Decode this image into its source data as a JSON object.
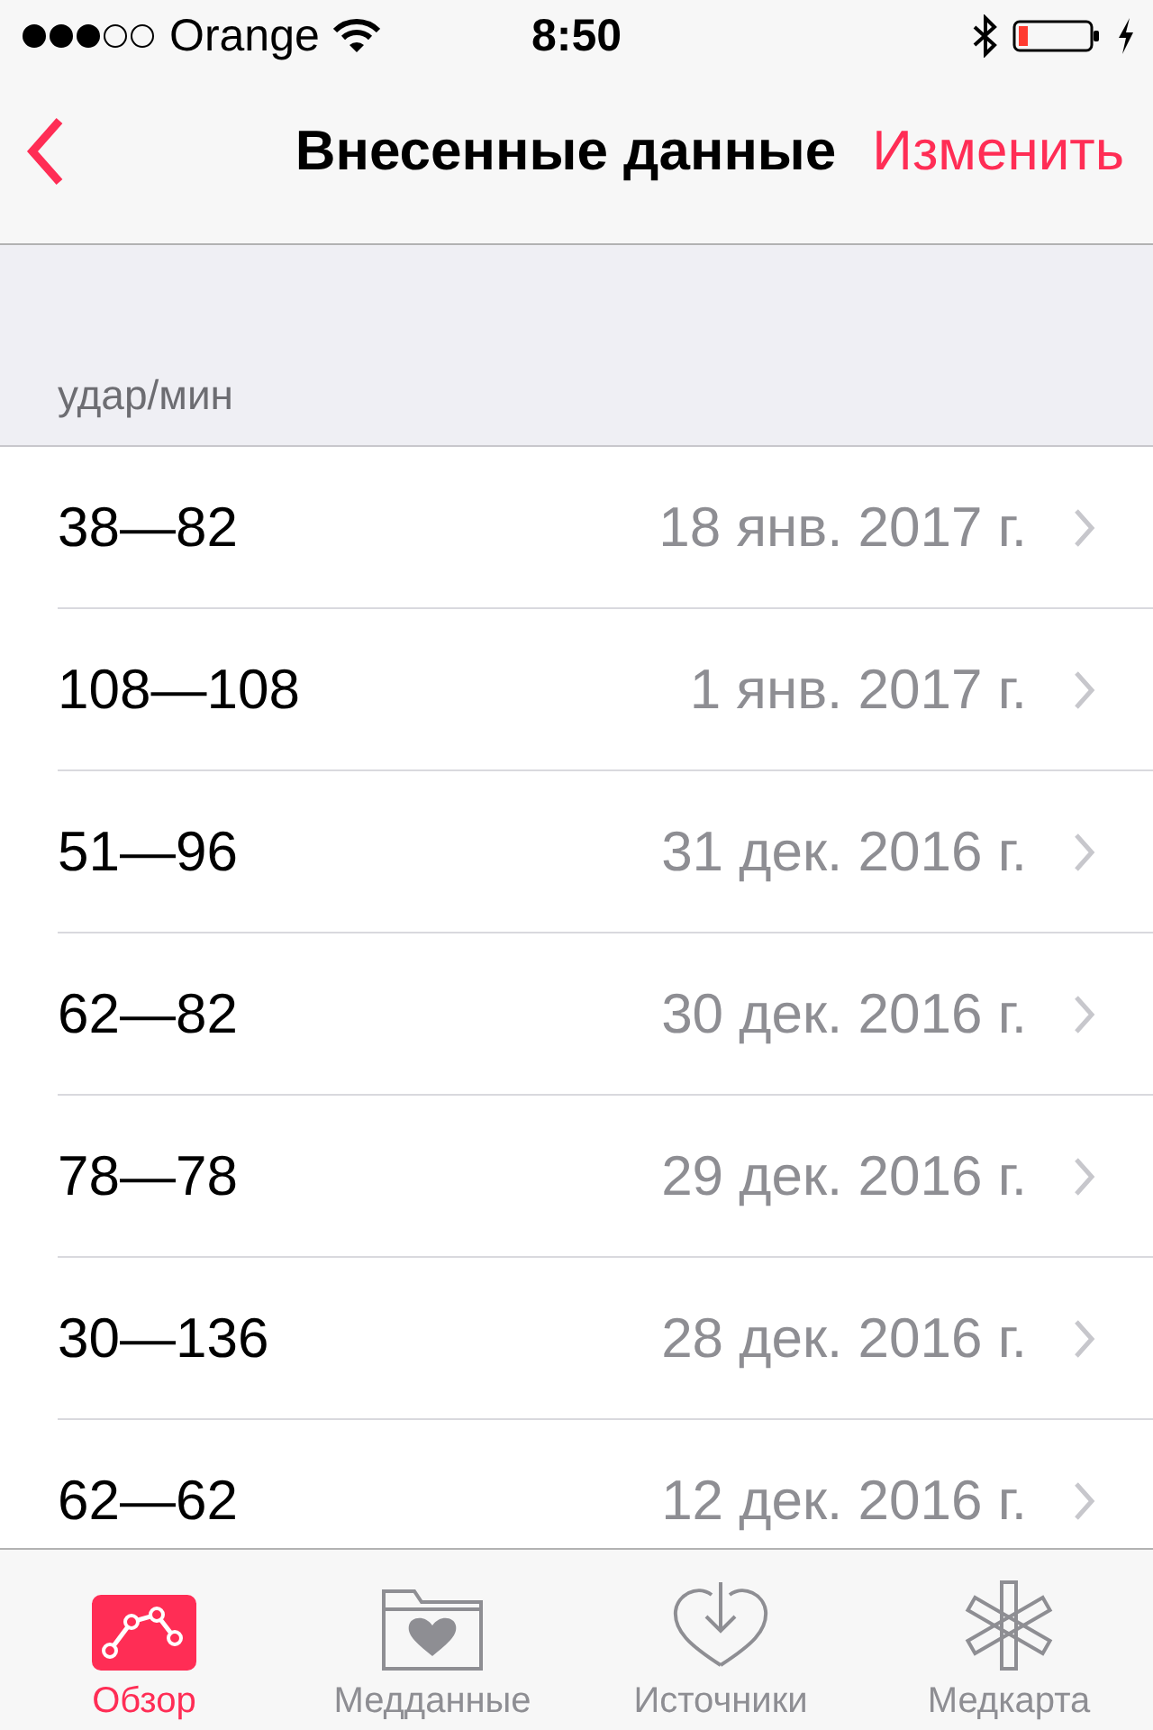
{
  "status_bar": {
    "carrier": "Orange",
    "time": "8:50"
  },
  "nav": {
    "title": "Внесенные данные",
    "action": "Изменить"
  },
  "section_header": "удар/мин",
  "rows": [
    {
      "value": "38—82",
      "date": "18 янв. 2017 г."
    },
    {
      "value": "108—108",
      "date": "1 янв. 2017 г."
    },
    {
      "value": "51—96",
      "date": "31 дек. 2016 г."
    },
    {
      "value": "62—82",
      "date": "30 дек. 2016 г."
    },
    {
      "value": "78—78",
      "date": "29 дек. 2016 г."
    },
    {
      "value": "30—136",
      "date": "28 дек. 2016 г."
    },
    {
      "value": "62—62",
      "date": "12 дек. 2016 г."
    }
  ],
  "tabs": [
    {
      "label": "Обзор",
      "selected": true
    },
    {
      "label": "Медданные",
      "selected": false
    },
    {
      "label": "Источники",
      "selected": false
    },
    {
      "label": "Медкарта",
      "selected": false
    }
  ]
}
